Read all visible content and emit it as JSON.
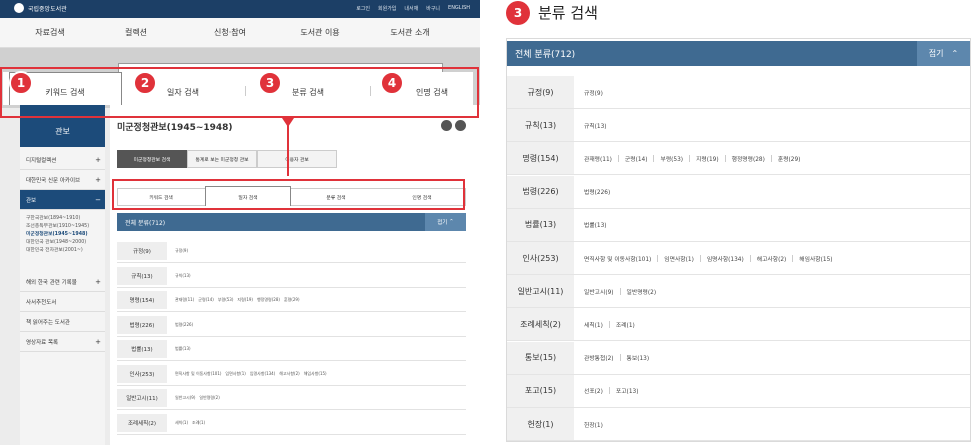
{
  "site": {
    "name": "국립중앙도서관",
    "util_links": [
      "로그인",
      "회원가입",
      "내서재",
      "바구니",
      "ENGLISH"
    ]
  },
  "gnb": [
    "자료검색",
    "컬렉션",
    "신청·참여",
    "도서관 이용",
    "도서관 소개"
  ],
  "search_tabs": [
    {
      "num": "1",
      "label": "키워드 검색"
    },
    {
      "num": "2",
      "label": "일자 검색"
    },
    {
      "num": "3",
      "label": "분류 검색"
    },
    {
      "num": "4",
      "label": "인명 검색"
    }
  ],
  "lnb": {
    "title": "관보",
    "items": [
      "디지털컬렉션",
      "대한민국 신문 아카이브",
      "관보",
      "해외 한국 관련 기록물",
      "사서추천도서",
      "책 읽어주는 도서관",
      "영상자료 목록"
    ],
    "sub_items": [
      "구한국관보(1894~1910)",
      "조선총독부관보(1910~1945)",
      "미군정청관보(1945~1948)",
      "대한민국 관보(1948~2000)",
      "대한민국 전자관보(2001~)"
    ]
  },
  "content": {
    "heading": "미군정청관보(1945~1948)",
    "sub_tabs": [
      "미군정청관보 검색",
      "통계로 보는 미군정청 관보",
      "이용자 관보"
    ]
  },
  "panel": {
    "section_num": "3",
    "section_title": "분류 검색",
    "header_label": "전체 분류(712)",
    "fold_label": "접기",
    "fold_icon": "chevron-up-icon",
    "rows": [
      {
        "label": "규정(9)",
        "items": [
          "규정(9)"
        ]
      },
      {
        "label": "규칙(13)",
        "items": [
          "규칙(13)"
        ]
      },
      {
        "label": "명령(154)",
        "items": [
          "관재령(11)",
          "군령(14)",
          "부령(53)",
          "지령(19)",
          "행정명령(28)",
          "훈령(29)"
        ]
      },
      {
        "label": "법령(226)",
        "items": [
          "법령(226)"
        ]
      },
      {
        "label": "법률(13)",
        "items": [
          "법률(13)"
        ]
      },
      {
        "label": "인사(253)",
        "items": [
          "면직사항 및 이동사항(101)",
          "임면사항(1)",
          "임명사항(134)",
          "해고사항(2)",
          "해임사항(15)"
        ]
      },
      {
        "label": "일반고시(11)",
        "items": [
          "일반고시(9)",
          "일반명령(2)"
        ]
      },
      {
        "label": "조례세칙(2)",
        "items": [
          "세칙(1)",
          "조례(1)"
        ]
      },
      {
        "label": "통보(15)",
        "items": [
          "관방통첩(2)",
          "통보(13)"
        ]
      },
      {
        "label": "포고(15)",
        "items": [
          "선포(2)",
          "포고(13)"
        ]
      },
      {
        "label": "헌장(1)",
        "items": [
          "헌장(1)"
        ]
      }
    ]
  },
  "colors": {
    "accent_red": "#e0323a",
    "header_blue": "#3f6a91",
    "navy": "#1c3f66"
  }
}
